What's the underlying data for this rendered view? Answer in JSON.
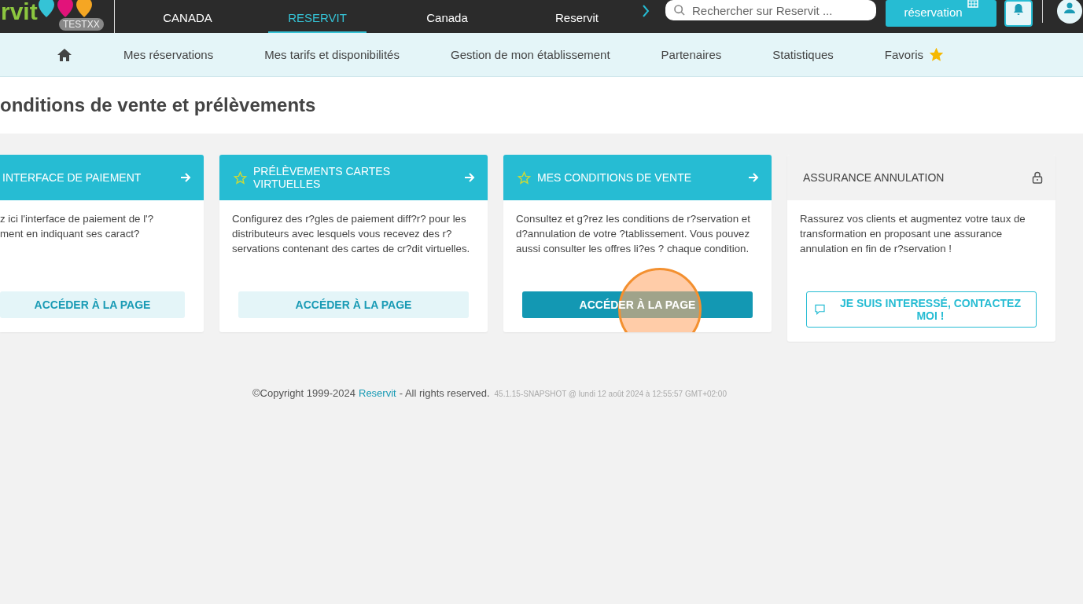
{
  "header": {
    "logo": "rvit",
    "badge": "TESTXX",
    "products": [
      {
        "label": "CANADA",
        "selected": false
      },
      {
        "label": "RESERVIT",
        "selected": true
      },
      {
        "label": "Canada",
        "selected": false
      },
      {
        "label": "Reservit",
        "selected": false
      }
    ],
    "search": {
      "placeholder": "Rechercher sur Reservit ..."
    },
    "book_button": "réservation"
  },
  "nav": {
    "items": [
      {
        "kind": "home"
      },
      {
        "kind": "text",
        "label": "Mes réservations"
      },
      {
        "kind": "text",
        "label": "Mes tarifs et disponibilités"
      },
      {
        "kind": "text",
        "label": "Gestion de mon établissement"
      },
      {
        "kind": "text",
        "label": "Partenaires"
      },
      {
        "kind": "text",
        "label": "Statistiques"
      },
      {
        "kind": "favorite",
        "label": "Favoris"
      }
    ]
  },
  "page_title": "onditions de vente et prélèvements",
  "cards": [
    {
      "kind": "link",
      "starred": false,
      "title": "INTERFACE DE PAIEMENT",
      "text": "z ici l'interface de paiement de l'?\nment en indiquant ses caract?",
      "button": "ACCÉDER À LA PAGE",
      "pressed": false
    },
    {
      "kind": "link",
      "starred": true,
      "title": "PRÉLÈVEMENTS CARTES VIRTUELLES",
      "text": "Configurez des r?gles de paiement diff?r? pour les distributeurs avec lesquels vous recevez des r?servations contenant des cartes de cr?dit virtuelles.",
      "button": "ACCÉDER À LA PAGE",
      "pressed": false
    },
    {
      "kind": "link",
      "starred": true,
      "title": "MES CONDITIONS DE VENTE",
      "text": "Consultez et g?rez les conditions de r?servation et d?annulation de votre ?tablissement. Vous pouvez aussi consulter les offres li?es ? chaque condition.",
      "button": "ACCÉDER À LA PAGE",
      "pressed": true
    },
    {
      "kind": "locked",
      "starred": false,
      "title": "ASSURANCE ANNULATION",
      "text": "Rassurez vos clients et augmentez votre taux de transformation en proposant une assurance annulation en fin de r?servation !",
      "button": "JE SUIS INTERESSÉ, CONTACTEZ MOI !",
      "pressed": false
    }
  ],
  "footer": {
    "copyright": "©Copyright 1999-2024",
    "link": "Reservit",
    "rights": "- All rights reserved.",
    "version": "45.1.15-SNAPSHOT @ lundi 12 août 2024 à 12:55:57 GMT+02:00"
  }
}
